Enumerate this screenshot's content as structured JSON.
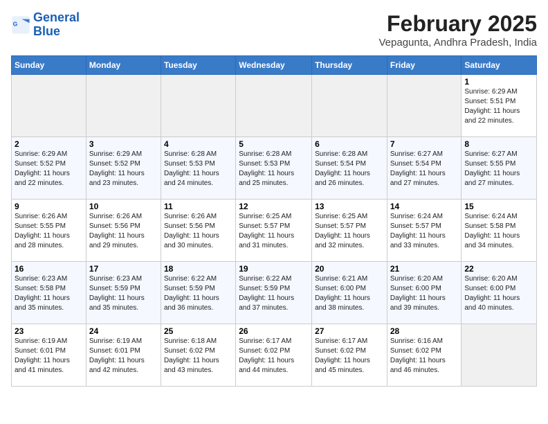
{
  "logo": {
    "line1": "General",
    "line2": "Blue"
  },
  "title": "February 2025",
  "subtitle": "Vepagunta, Andhra Pradesh, India",
  "days_of_week": [
    "Sunday",
    "Monday",
    "Tuesday",
    "Wednesday",
    "Thursday",
    "Friday",
    "Saturday"
  ],
  "weeks": [
    [
      {
        "num": "",
        "info": ""
      },
      {
        "num": "",
        "info": ""
      },
      {
        "num": "",
        "info": ""
      },
      {
        "num": "",
        "info": ""
      },
      {
        "num": "",
        "info": ""
      },
      {
        "num": "",
        "info": ""
      },
      {
        "num": "1",
        "info": "Sunrise: 6:29 AM\nSunset: 5:51 PM\nDaylight: 11 hours\nand 22 minutes."
      }
    ],
    [
      {
        "num": "2",
        "info": "Sunrise: 6:29 AM\nSunset: 5:52 PM\nDaylight: 11 hours\nand 22 minutes."
      },
      {
        "num": "3",
        "info": "Sunrise: 6:29 AM\nSunset: 5:52 PM\nDaylight: 11 hours\nand 23 minutes."
      },
      {
        "num": "4",
        "info": "Sunrise: 6:28 AM\nSunset: 5:53 PM\nDaylight: 11 hours\nand 24 minutes."
      },
      {
        "num": "5",
        "info": "Sunrise: 6:28 AM\nSunset: 5:53 PM\nDaylight: 11 hours\nand 25 minutes."
      },
      {
        "num": "6",
        "info": "Sunrise: 6:28 AM\nSunset: 5:54 PM\nDaylight: 11 hours\nand 26 minutes."
      },
      {
        "num": "7",
        "info": "Sunrise: 6:27 AM\nSunset: 5:54 PM\nDaylight: 11 hours\nand 27 minutes."
      },
      {
        "num": "8",
        "info": "Sunrise: 6:27 AM\nSunset: 5:55 PM\nDaylight: 11 hours\nand 27 minutes."
      }
    ],
    [
      {
        "num": "9",
        "info": "Sunrise: 6:26 AM\nSunset: 5:55 PM\nDaylight: 11 hours\nand 28 minutes."
      },
      {
        "num": "10",
        "info": "Sunrise: 6:26 AM\nSunset: 5:56 PM\nDaylight: 11 hours\nand 29 minutes."
      },
      {
        "num": "11",
        "info": "Sunrise: 6:26 AM\nSunset: 5:56 PM\nDaylight: 11 hours\nand 30 minutes."
      },
      {
        "num": "12",
        "info": "Sunrise: 6:25 AM\nSunset: 5:57 PM\nDaylight: 11 hours\nand 31 minutes."
      },
      {
        "num": "13",
        "info": "Sunrise: 6:25 AM\nSunset: 5:57 PM\nDaylight: 11 hours\nand 32 minutes."
      },
      {
        "num": "14",
        "info": "Sunrise: 6:24 AM\nSunset: 5:57 PM\nDaylight: 11 hours\nand 33 minutes."
      },
      {
        "num": "15",
        "info": "Sunrise: 6:24 AM\nSunset: 5:58 PM\nDaylight: 11 hours\nand 34 minutes."
      }
    ],
    [
      {
        "num": "16",
        "info": "Sunrise: 6:23 AM\nSunset: 5:58 PM\nDaylight: 11 hours\nand 35 minutes."
      },
      {
        "num": "17",
        "info": "Sunrise: 6:23 AM\nSunset: 5:59 PM\nDaylight: 11 hours\nand 35 minutes."
      },
      {
        "num": "18",
        "info": "Sunrise: 6:22 AM\nSunset: 5:59 PM\nDaylight: 11 hours\nand 36 minutes."
      },
      {
        "num": "19",
        "info": "Sunrise: 6:22 AM\nSunset: 5:59 PM\nDaylight: 11 hours\nand 37 minutes."
      },
      {
        "num": "20",
        "info": "Sunrise: 6:21 AM\nSunset: 6:00 PM\nDaylight: 11 hours\nand 38 minutes."
      },
      {
        "num": "21",
        "info": "Sunrise: 6:20 AM\nSunset: 6:00 PM\nDaylight: 11 hours\nand 39 minutes."
      },
      {
        "num": "22",
        "info": "Sunrise: 6:20 AM\nSunset: 6:00 PM\nDaylight: 11 hours\nand 40 minutes."
      }
    ],
    [
      {
        "num": "23",
        "info": "Sunrise: 6:19 AM\nSunset: 6:01 PM\nDaylight: 11 hours\nand 41 minutes."
      },
      {
        "num": "24",
        "info": "Sunrise: 6:19 AM\nSunset: 6:01 PM\nDaylight: 11 hours\nand 42 minutes."
      },
      {
        "num": "25",
        "info": "Sunrise: 6:18 AM\nSunset: 6:02 PM\nDaylight: 11 hours\nand 43 minutes."
      },
      {
        "num": "26",
        "info": "Sunrise: 6:17 AM\nSunset: 6:02 PM\nDaylight: 11 hours\nand 44 minutes."
      },
      {
        "num": "27",
        "info": "Sunrise: 6:17 AM\nSunset: 6:02 PM\nDaylight: 11 hours\nand 45 minutes."
      },
      {
        "num": "28",
        "info": "Sunrise: 6:16 AM\nSunset: 6:02 PM\nDaylight: 11 hours\nand 46 minutes."
      },
      {
        "num": "",
        "info": ""
      }
    ]
  ]
}
